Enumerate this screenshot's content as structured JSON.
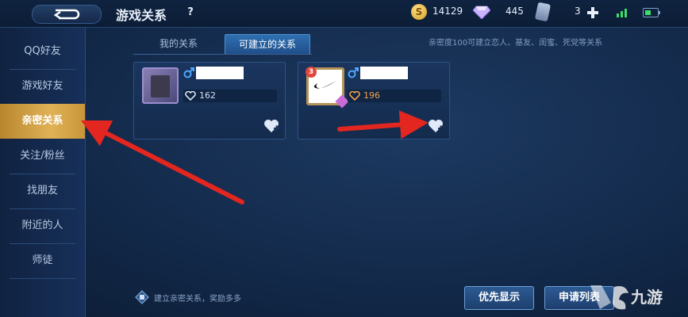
{
  "header": {
    "title": "游戏关系",
    "help_label": "?",
    "gold_symbol": "S",
    "gold": "14129",
    "diamonds": "445",
    "tickets": "3"
  },
  "sidebar": {
    "items": [
      {
        "label": "QQ好友"
      },
      {
        "label": "游戏好友"
      },
      {
        "label": "亲密关系"
      },
      {
        "label": "关注/粉丝"
      },
      {
        "label": "找朋友"
      },
      {
        "label": "附近的人"
      },
      {
        "label": "师徒"
      }
    ],
    "active_index": 2
  },
  "tabs": [
    {
      "label": "我的关系"
    },
    {
      "label": "可建立的关系"
    }
  ],
  "hint": "亲密度100可建立恋人、基友、闺蜜、死党等关系",
  "cards": [
    {
      "gender": "male",
      "intimacy": "162",
      "heart_color": "#d9e4f2"
    },
    {
      "gender": "male",
      "intimacy": "196",
      "heart_color": "#f2a14a",
      "rank_badge": "3"
    }
  ],
  "footer": {
    "tip": "建立亲密关系，奖励多多",
    "priority_button": "优先显示",
    "requests_button": "申请列表"
  },
  "watermark": "九游",
  "colors": {
    "accent_gold": "#e0b256",
    "arrow_red": "#e3261f",
    "button_border": "#6d9fd6"
  }
}
